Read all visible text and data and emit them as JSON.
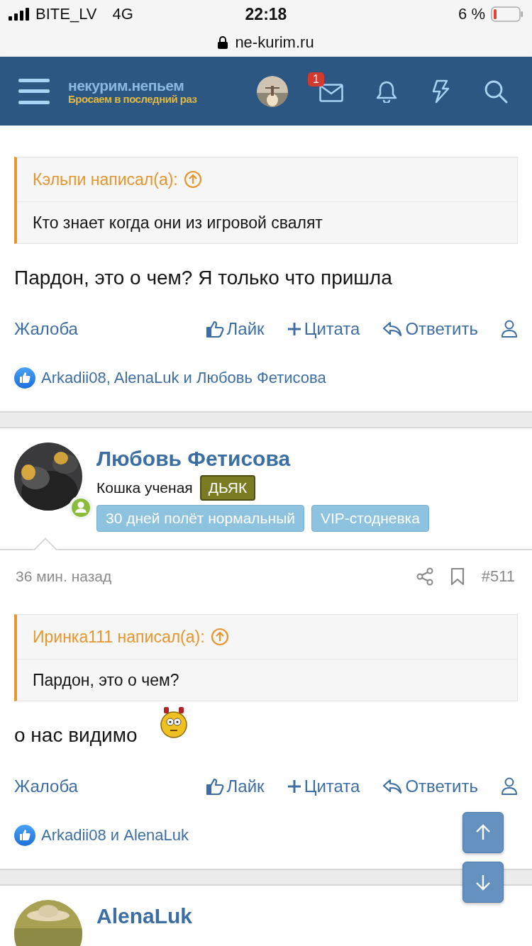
{
  "status_bar": {
    "carrier": "BITE_LV",
    "network": "4G",
    "time": "22:18",
    "battery": "6 %"
  },
  "address_bar": {
    "url": "ne-kurim.ru"
  },
  "header": {
    "logo_title": "некурим.непьем",
    "logo_tagline": "Бросаем в последний раз",
    "message_badge": "1"
  },
  "previous_post": {
    "quote": {
      "author_line": "Кэльпи написал(а):",
      "text": "Кто знает когда они из игровой свалят"
    },
    "body": [
      {
        "kind": "text",
        "text": "Пардон, это о чем? Я только что пришла"
      }
    ],
    "actions": [
      {
        "kind": "report",
        "label": "Жалоба"
      },
      {
        "kind": "like",
        "label": "Лайк"
      },
      {
        "kind": "quote",
        "label": "Цитата"
      },
      {
        "kind": "reply",
        "label": "Ответить"
      }
    ],
    "reactions": "Arkadii08, AlenaLuk и Любовь Фетисова"
  },
  "post": {
    "author": "Любовь Фетисова",
    "user_title": "Кошка ученая",
    "banner": "ДЬЯК",
    "badges": [
      "30 дней полёт нормальный",
      "VIP-стодневка"
    ],
    "time": "36 мин. назад",
    "number": "#511",
    "quote": {
      "author_line": "Иринка111 написал(а):",
      "text": "Пардон, это о чем?"
    },
    "body": [
      {
        "kind": "text",
        "text": "о нас видимо"
      },
      {
        "kind": "smiley"
      }
    ],
    "actions": [
      {
        "kind": "report",
        "label": "Жалоба"
      },
      {
        "kind": "like",
        "label": "Лайк"
      },
      {
        "kind": "quote",
        "label": "Цитата"
      },
      {
        "kind": "reply",
        "label": "Ответить"
      }
    ],
    "reactions": "Arkadii08 и AlenaLuk"
  },
  "next_post": {
    "author": "AlenaLuk"
  }
}
